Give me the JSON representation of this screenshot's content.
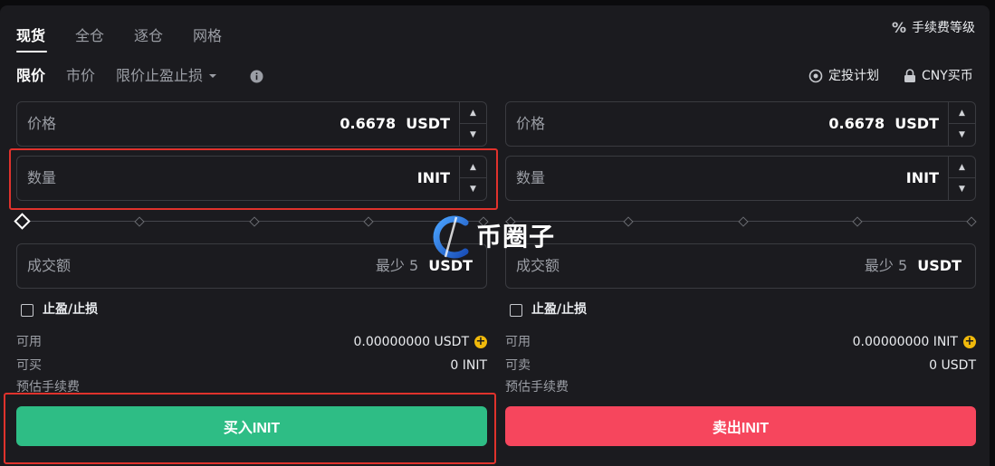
{
  "tabs": [
    {
      "label": "现货",
      "active": true
    },
    {
      "label": "全仓",
      "active": false
    },
    {
      "label": "逐仓",
      "active": false
    },
    {
      "label": "网格",
      "active": false
    }
  ],
  "fee_level": {
    "label": "手续费等级",
    "icon": "percent-icon"
  },
  "order_types": [
    {
      "label": "限价",
      "active": true
    },
    {
      "label": "市价",
      "active": false
    },
    {
      "label": "限价止盈止损",
      "active": false
    }
  ],
  "links": {
    "dca_plan": "定投计划",
    "cny_buy": "CNY买币"
  },
  "buy": {
    "price_label": "价格",
    "price_value": "0.6678",
    "price_unit": "USDT",
    "qty_label": "数量",
    "qty_unit": "INIT",
    "total_label": "成交额",
    "total_min": "最少 5",
    "total_unit": "USDT",
    "tpsl_label": "止盈/止损",
    "avail_label": "可用",
    "avail_value": "0.00000000 USDT",
    "max_label": "可买",
    "max_value": "0 INIT",
    "fee_label": "预估手续费",
    "button_label": "买入INIT"
  },
  "sell": {
    "price_label": "价格",
    "price_value": "0.6678",
    "price_unit": "USDT",
    "qty_label": "数量",
    "qty_unit": "INIT",
    "total_label": "成交额",
    "total_min": "最少 5",
    "total_unit": "USDT",
    "tpsl_label": "止盈/止损",
    "avail_label": "可用",
    "avail_value": "0.00000000 INIT",
    "max_label": "可卖",
    "max_value": "0 USDT",
    "fee_label": "预估手续费",
    "button_label": "卖出INIT"
  },
  "watermark": {
    "text": "币圈子"
  },
  "colors": {
    "buy": "#2ebd85",
    "sell": "#f6465d",
    "accent": "#f0b90b",
    "highlight": "#e0322c"
  }
}
